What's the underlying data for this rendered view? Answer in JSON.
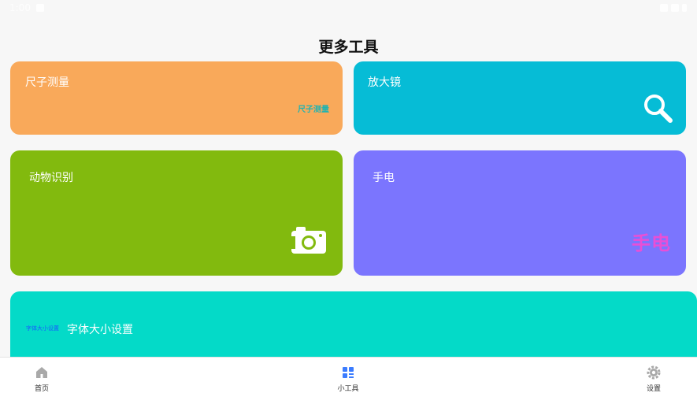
{
  "status_bar": {
    "time": "1:00"
  },
  "page": {
    "title": "更多工具"
  },
  "tools": [
    {
      "label": "尺子测量",
      "badge": "尺子测量",
      "bg": "#f9a95a"
    },
    {
      "label": "放大镜",
      "icon": "magnifier-icon",
      "bg": "#06bcd6"
    },
    {
      "label": "动物识别",
      "icon": "camera-icon",
      "bg": "#82ba0e"
    },
    {
      "label": "手电",
      "badge": "手电",
      "bg": "#7b75fe"
    },
    {
      "label": "字体大小设置",
      "badge": "字体大小设置",
      "bg": "#04dac8"
    }
  ],
  "nav": [
    {
      "label": "首页",
      "icon": "home-icon"
    },
    {
      "label": "小工具",
      "icon": "grid-icon",
      "active": true
    },
    {
      "label": "设置",
      "icon": "gear-icon"
    }
  ],
  "colors": {
    "accent": "#3b7cff",
    "nav_inactive": "#a9a9a9"
  }
}
